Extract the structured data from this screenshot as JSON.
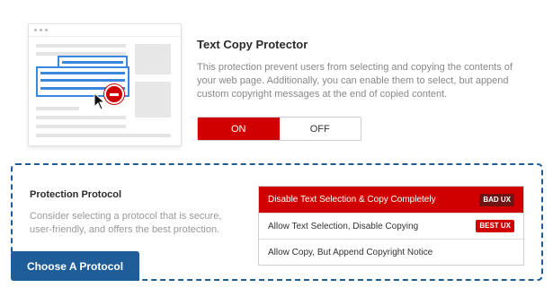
{
  "protector": {
    "title": "Text Copy Protector",
    "description": "This protection prevent users from selecting and copying the contents of your web page. Additionally, you can enable them to select, but append custom copyright messages at the end of copied content.",
    "toggle": {
      "on_label": "ON",
      "off_label": "OFF",
      "selected": "ON"
    }
  },
  "protocol": {
    "title": "Protection Protocol",
    "description": "Consider selecting a protocol that is secure, user-friendly, and offers the best protection.",
    "options": [
      {
        "label": "Disable Text Selection & Copy Completely",
        "badge": "BAD UX",
        "selected": true
      },
      {
        "label": "Allow Text Selection, Disable Copying",
        "badge": "BEST UX",
        "selected": false
      },
      {
        "label": "Allow Copy, But Append Copyright Notice",
        "badge": "",
        "selected": false
      }
    ],
    "cta_label": "Choose A Protocol"
  },
  "colors": {
    "accent_red": "#d10000",
    "brand_blue": "#1f5d98",
    "selection_blue": "#3a87e0"
  },
  "illustration": {
    "icons": [
      "stop-icon",
      "cursor-arrow-icon"
    ]
  }
}
